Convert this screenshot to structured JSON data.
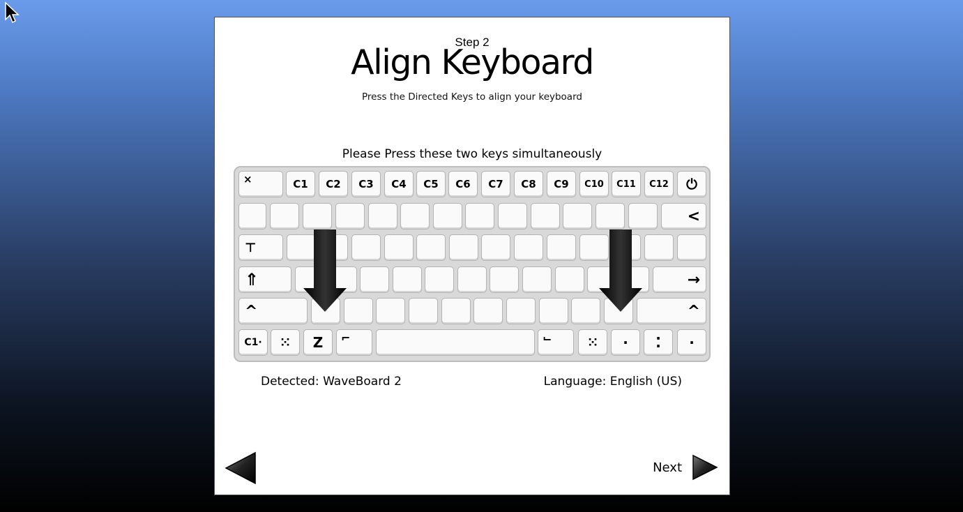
{
  "header": {
    "step": "Step 2",
    "title": "Align Keyboard",
    "subtitle": "Press the Directed Keys to align your keyboard"
  },
  "instruction": "Please Press these two keys simultaneously",
  "keyboard": {
    "row1": [
      "×",
      "C1",
      "C2",
      "C3",
      "C4",
      "C5",
      "C6",
      "C7",
      "C8",
      "C9",
      "C10",
      "C11",
      "C12",
      "⏻"
    ],
    "row2_right": "<",
    "row3_left": "⊤",
    "row4_left": "⇑",
    "row4_right": "→",
    "row5_left": "^",
    "row5_right": "^",
    "row6": [
      "C1·",
      "⁙",
      "Z",
      "⌐",
      "⌙",
      "⁙",
      "·",
      "⁚",
      "·"
    ]
  },
  "status": {
    "detected": "Detected: WaveBoard 2",
    "language": "Language: English (US)"
  },
  "nav": {
    "next_label": "Next"
  },
  "icons": {
    "cursor": "mouse-pointer-icon",
    "back": "triangle-left-icon",
    "next": "triangle-right-icon",
    "indicator": "arrow-down-icon"
  }
}
